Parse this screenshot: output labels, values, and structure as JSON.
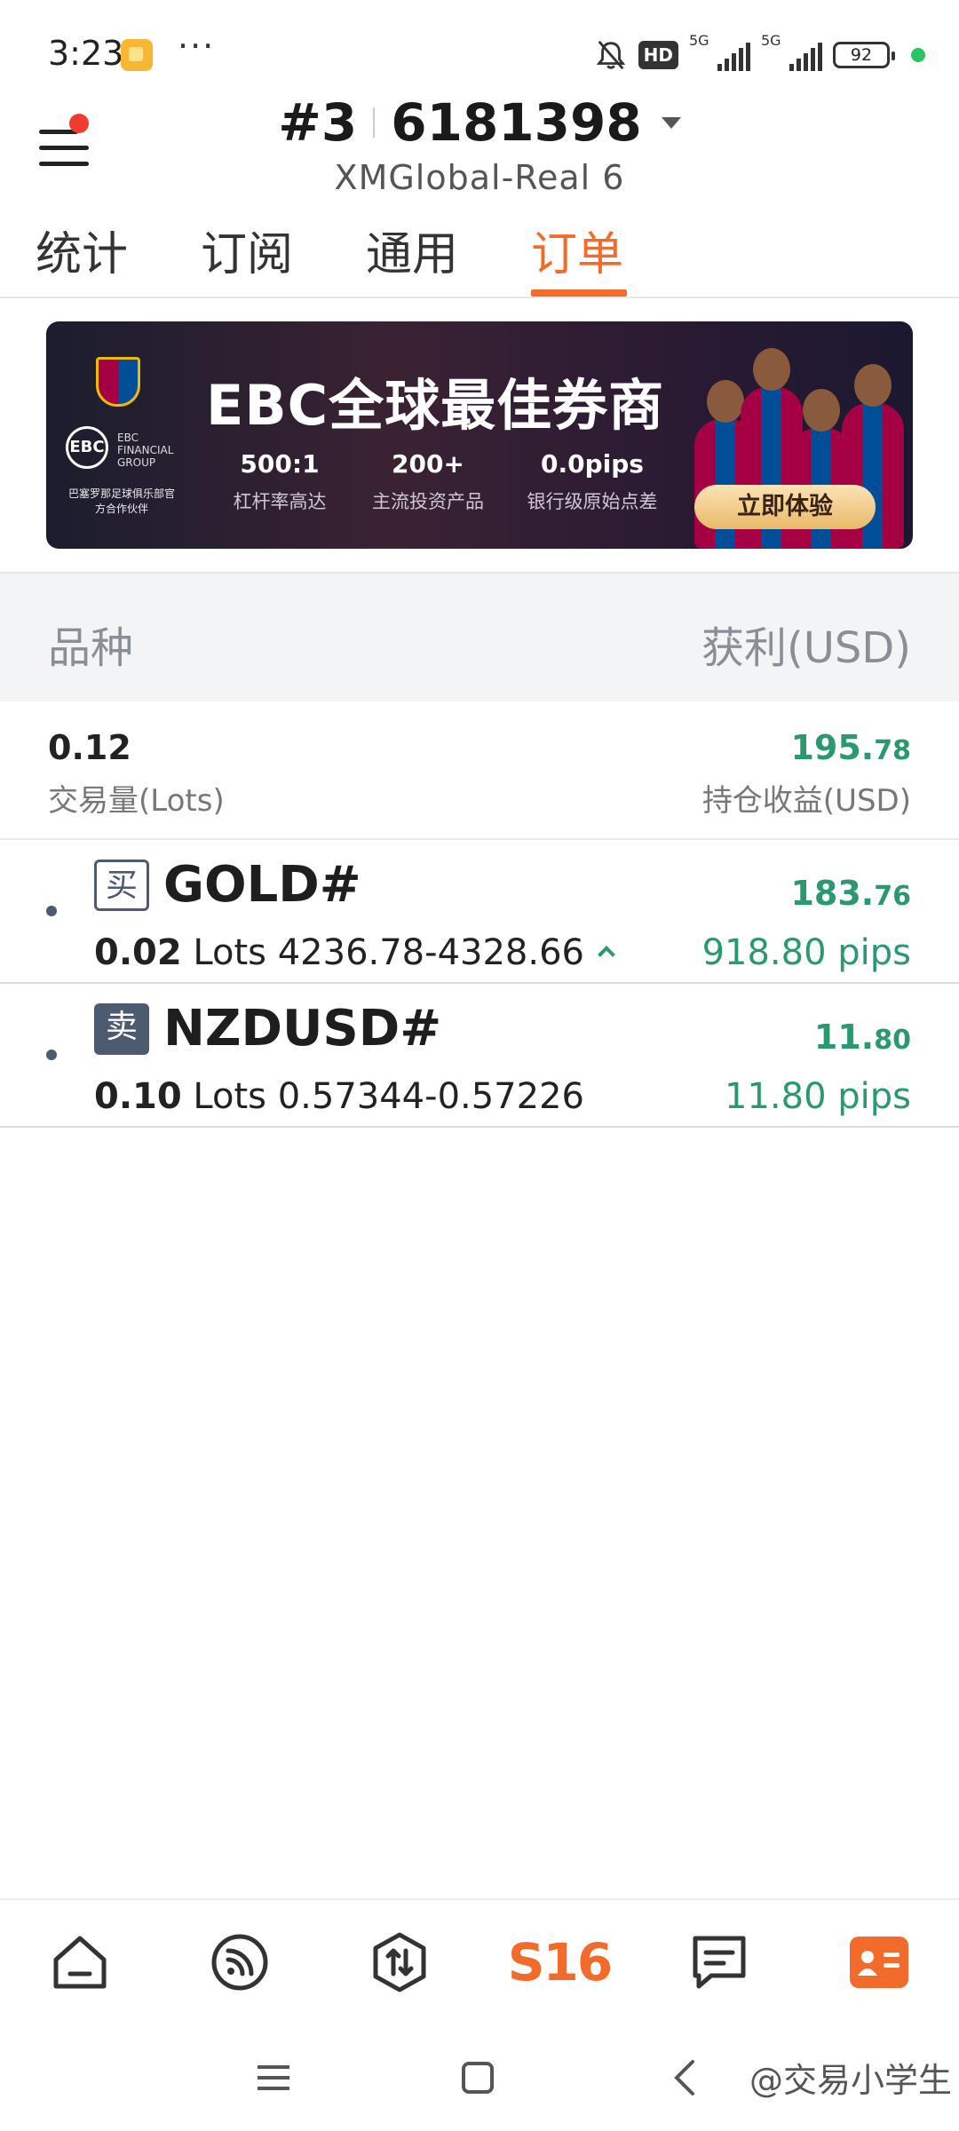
{
  "status_bar": {
    "time": "3:23",
    "overflow": "···",
    "hd": "HD",
    "sim1": "5G",
    "sim2": "5G",
    "battery": "92"
  },
  "header": {
    "account_prefix": "#3",
    "account_number": "6181398",
    "server": "XMGlobal-Real 6"
  },
  "tabs": [
    {
      "label": "统计"
    },
    {
      "label": "订阅"
    },
    {
      "label": "通用"
    },
    {
      "label": "订单"
    }
  ],
  "banner": {
    "title": "EBC全球最佳券商",
    "logo": "EBC",
    "company": "EBC FINANCIAL GROUP",
    "partner": "巴塞罗那足球俱乐部官方合作伙伴",
    "stats": [
      {
        "value": "500:1",
        "label": "杠杆率高达"
      },
      {
        "value": "200+",
        "label": "主流投资产品"
      },
      {
        "value": "0.0pips",
        "label": "银行级原始点差"
      }
    ],
    "cta": "立即体验"
  },
  "list_header": {
    "left": "品种",
    "right": "获利(USD)"
  },
  "summary": {
    "volume": "0.12",
    "volume_label": "交易量(Lots)",
    "profit_int": "195.",
    "profit_dec": "78",
    "profit_label": "持仓收益(USD)"
  },
  "positions": [
    {
      "side": "买",
      "symbol": "GOLD#",
      "lots": "0.02",
      "lots_unit": "Lots",
      "prices": "4236.78-4328.66",
      "profit_int": "183.",
      "profit_dec": "76",
      "pips": "918.80 pips"
    },
    {
      "side": "卖",
      "symbol": "NZDUSD#",
      "lots": "0.10",
      "lots_unit": "Lots",
      "prices": "0.57344-0.57226",
      "profit_int": "11.",
      "profit_dec": "80",
      "pips": "11.80 pips"
    }
  ],
  "bottom_nav": {
    "items": [
      "home-icon",
      "feed-icon",
      "trade-icon",
      "s16-logo",
      "chat-icon",
      "profile-icon"
    ],
    "s16_label": "S16"
  },
  "watermark": "@交易小学生",
  "colors": {
    "accent": "#f36b2b",
    "profit_green": "#2a9a6e",
    "side_badge": "#4e5a6f"
  }
}
